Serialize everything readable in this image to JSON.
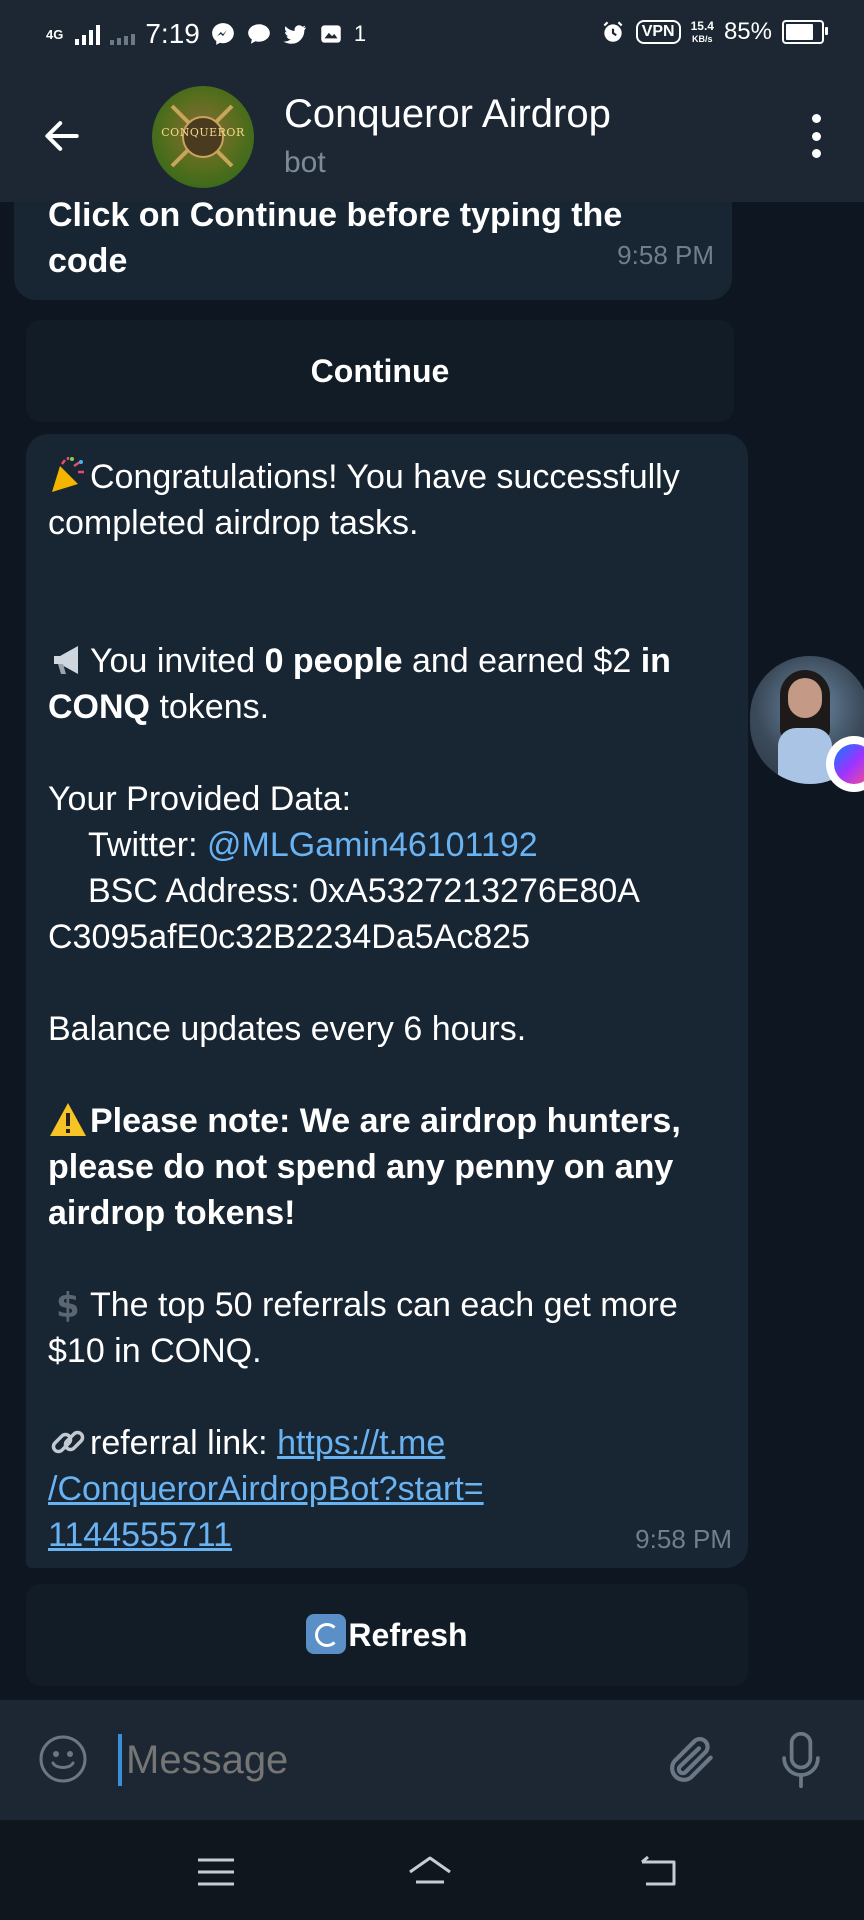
{
  "status_bar": {
    "network": "4G",
    "time": "7:19",
    "notif_count": "1",
    "vpn": "VPN",
    "speed_value": "15.4",
    "speed_unit": "KB/s",
    "battery": "85%"
  },
  "header": {
    "title": "Conqueror Airdrop",
    "subtitle": "bot",
    "avatar_text": "CONQUEROR"
  },
  "messages": {
    "first": {
      "text": "Click on Continue before typing the code",
      "time": "9:58 PM"
    },
    "continue_button": "Continue",
    "second": {
      "congrats": "Congratulations! You have successfully completed airdrop tasks.",
      "invited_pre": "You invited ",
      "invited_bold": "0 people",
      "invited_mid": " and earned $2 ",
      "invited_bold2": "in CONQ",
      "invited_post": " tokens.",
      "data_heading": "Your Provided Data:",
      "twitter_label": "Twitter: ",
      "twitter_handle": "@MLGamin46101192",
      "bsc_label": "BSC Address: ",
      "bsc_address_1": "0xA5327213276E80A",
      "bsc_address_2": "C3095afE0c32B2234Da5Ac825",
      "balance_note": "Balance updates every 6 hours.",
      "warning": "Please note: We are airdrop hunters, please do not spend any penny on any airdrop tokens!",
      "top_referrals": "The top 50 referrals can each get more $10 in CONQ.",
      "referral_label": "referral link: ",
      "referral_url_1": "https://t.me",
      "referral_url_2": "/ConquerorAirdropBot?start=",
      "referral_url_3": "1144555711",
      "time": "9:58 PM"
    },
    "refresh_button": "Refresh"
  },
  "input": {
    "placeholder": "Message"
  },
  "icons": {
    "back": "arrow-left-icon",
    "menu": "more-vertical-icon",
    "emoji": "smiley-icon",
    "attach": "paperclip-icon",
    "mic": "microphone-icon"
  },
  "colors": {
    "background": "#0e1621",
    "bubble": "#182533",
    "header": "#1c2733",
    "link": "#6ab3f3"
  }
}
